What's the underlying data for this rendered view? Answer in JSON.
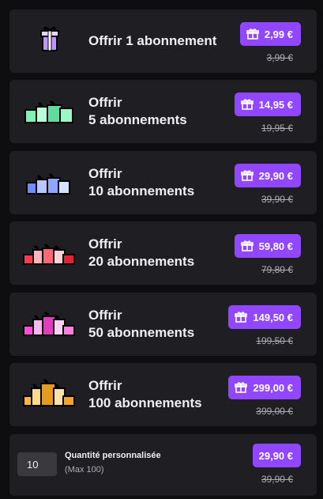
{
  "options": [
    {
      "title_lines": [
        "Offrir 1 abonnement"
      ],
      "price": "2,99 €",
      "old_price": "3,99 €",
      "gift_color": "#bf94ff",
      "icon": "single-gift-icon"
    },
    {
      "title_lines": [
        "Offrir",
        "5 abonnements"
      ],
      "price": "14,95 €",
      "old_price": "19,95 €",
      "gift_color": "#7cf2b4",
      "icon": "gift-pile-green-icon"
    },
    {
      "title_lines": [
        "Offrir",
        "10 abonnements"
      ],
      "price": "29,90 €",
      "old_price": "39,90 €",
      "gift_color": "#6f8dff",
      "icon": "gift-pile-blue-icon"
    },
    {
      "title_lines": [
        "Offrir",
        "20 abonnements"
      ],
      "price": "59,80 €",
      "old_price": "79,80 €",
      "gift_color": "#ff3b4d",
      "icon": "gift-pile-red-icon"
    },
    {
      "title_lines": [
        "Offrir",
        "50 abonnements"
      ],
      "price": "149,50 €",
      "old_price": "199,50 €",
      "gift_color": "#ff4fd8",
      "icon": "gift-pile-pink-icon"
    },
    {
      "title_lines": [
        "Offrir",
        "100 abonnements"
      ],
      "price": "299,00 €",
      "old_price": "399,00 €",
      "gift_color": "#ffb33b",
      "icon": "gift-pile-gold-icon"
    }
  ],
  "custom": {
    "quantity": "10",
    "label": "Quantité personnalisée",
    "sublabel": "(Max 100)",
    "price": "29,90 €",
    "old_price": "39,90 €"
  },
  "colors": {
    "accent": "#9147ff",
    "card_bg": "#1f1f23",
    "page_bg": "#0e0e10"
  }
}
